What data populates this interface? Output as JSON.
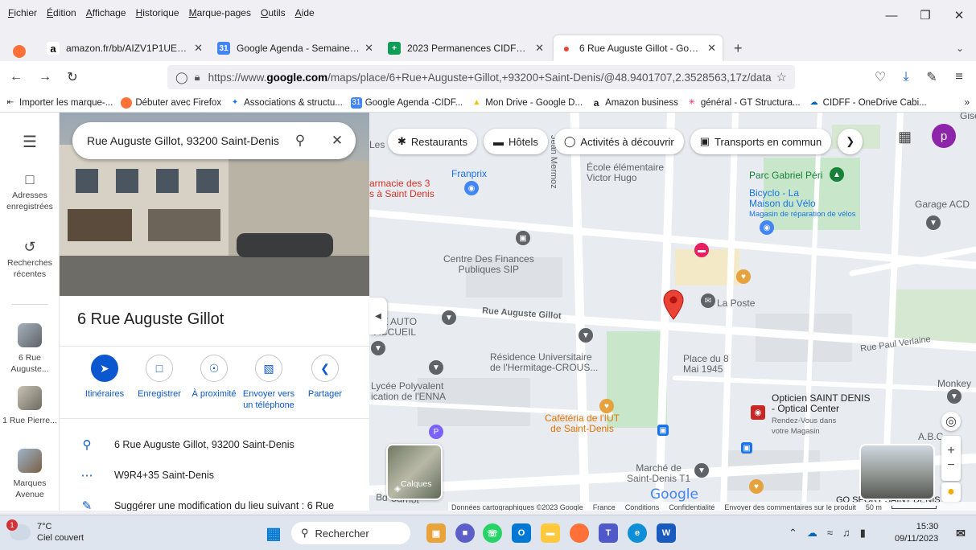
{
  "menu": [
    "Fichier",
    "Édition",
    "Affichage",
    "Historique",
    "Marque-pages",
    "Outils",
    "Aide"
  ],
  "tabs": [
    {
      "title": "amazon.fr/bb/AIZV1P1UEFWT7/",
      "favicon": "amazon-icon"
    },
    {
      "title": "Google Agenda - Semaine du 2",
      "favicon": "google-calendar-icon"
    },
    {
      "title": "2023 Permanences CIDFF 93 - C",
      "favicon": "google-sheets-icon"
    },
    {
      "title": "6 Rue Auguste Gillot - Google M",
      "favicon": "google-maps-icon",
      "active": true
    }
  ],
  "url": {
    "prefix": "https://www.",
    "domain": "google.com",
    "rest": "/maps/place/6+Rue+Auguste+Gillot,+93200+Saint-Denis/@48.9401707,2.3528563,17z/data"
  },
  "bookmarks": [
    "Importer les marque-...",
    "Débuter avec Firefox",
    "Associations & structu...",
    "Google Agenda -CIDF...",
    "Mon Drive - Google D...",
    "Amazon business",
    "général - GT Structura...",
    "CIDFF - OneDrive Cabi..."
  ],
  "rail": {
    "saved": "Adresses enregistrées",
    "recent": "Recherches récentes",
    "history": [
      "6 Rue Auguste...",
      "1 Rue Pierre...",
      "Marques Avenue"
    ]
  },
  "search": {
    "query": "Rue Auguste Gillot, 93200 Saint-Denis"
  },
  "place": {
    "title": "6 Rue Auguste Gillot",
    "actions": [
      "Itinéraires",
      "Enregistrer",
      "À proximité",
      "Envoyer vers un téléphone",
      "Partager"
    ],
    "address": "6 Rue Auguste Gillot, 93200 Saint-Denis",
    "plus_code": "W9R4+35 Saint-Denis",
    "suggest": "Suggérer une modification du lieu suivant : 6 Rue"
  },
  "chips": [
    "Restaurants",
    "Hôtels",
    "Activités à découvrir",
    "Transports en commun"
  ],
  "profile_initial": "p",
  "map_labels": {
    "gisele": "Gisele",
    "les": "Les",
    "pharmacie": "armacie des 3\ns à Saint Denis",
    "franprix": "Franprix",
    "jean_mermoz": "Jean Mermoz",
    "ecole": "École élémentaire\nVictor Hugo",
    "parc": "Parc Gabriel Péri",
    "bicyclo": "Bicyclo - La\nMaison du Vélo",
    "bicyclo_sub": "Magasin de réparation de vélos",
    "garage": "Garage ACD",
    "finances": "Centre Des Finances\nPubliques SIP",
    "laposte": "La Poste",
    "rue_gillot": "Rue Auguste Gillot",
    "ge_auto": "GE AUTO\nACCUEIL",
    "residence": "Résidence Universitaire\nde l'Hermitage-CROUS...",
    "rue_verlaine": "Rue Paul Verlaine",
    "place8mai": "Place du 8\nMai 1945",
    "monkey": "Monkey",
    "lycee": "Lycée Polyvalent\nication de l'ENNA",
    "optician": "Opticien SAINT DENIS\n- Optical Center",
    "optician_sub": "Rendez-Vous dans\nvotre Magasin",
    "abc": "A.B.C",
    "cafeteria": "Cafétéria de l'IUT\nde Saint-Denis",
    "marche": "Marché de\nSaint-Denis T1",
    "carnot": "Bd Carnot",
    "gosport": "GO SPORT SAINT DENIS"
  },
  "layers_label": "Calques",
  "google_logo": "Google",
  "attribution": [
    "Données cartographiques ©2023 Google",
    "France",
    "Conditions",
    "Confidentialité",
    "Envoyer des commentaires sur le produit",
    "50 m"
  ],
  "taskbar": {
    "temp": "7°C",
    "weather": "Ciel couvert",
    "weather_badge": "1",
    "search": "Rechercher",
    "time": "15:30",
    "date": "09/11/2023"
  }
}
